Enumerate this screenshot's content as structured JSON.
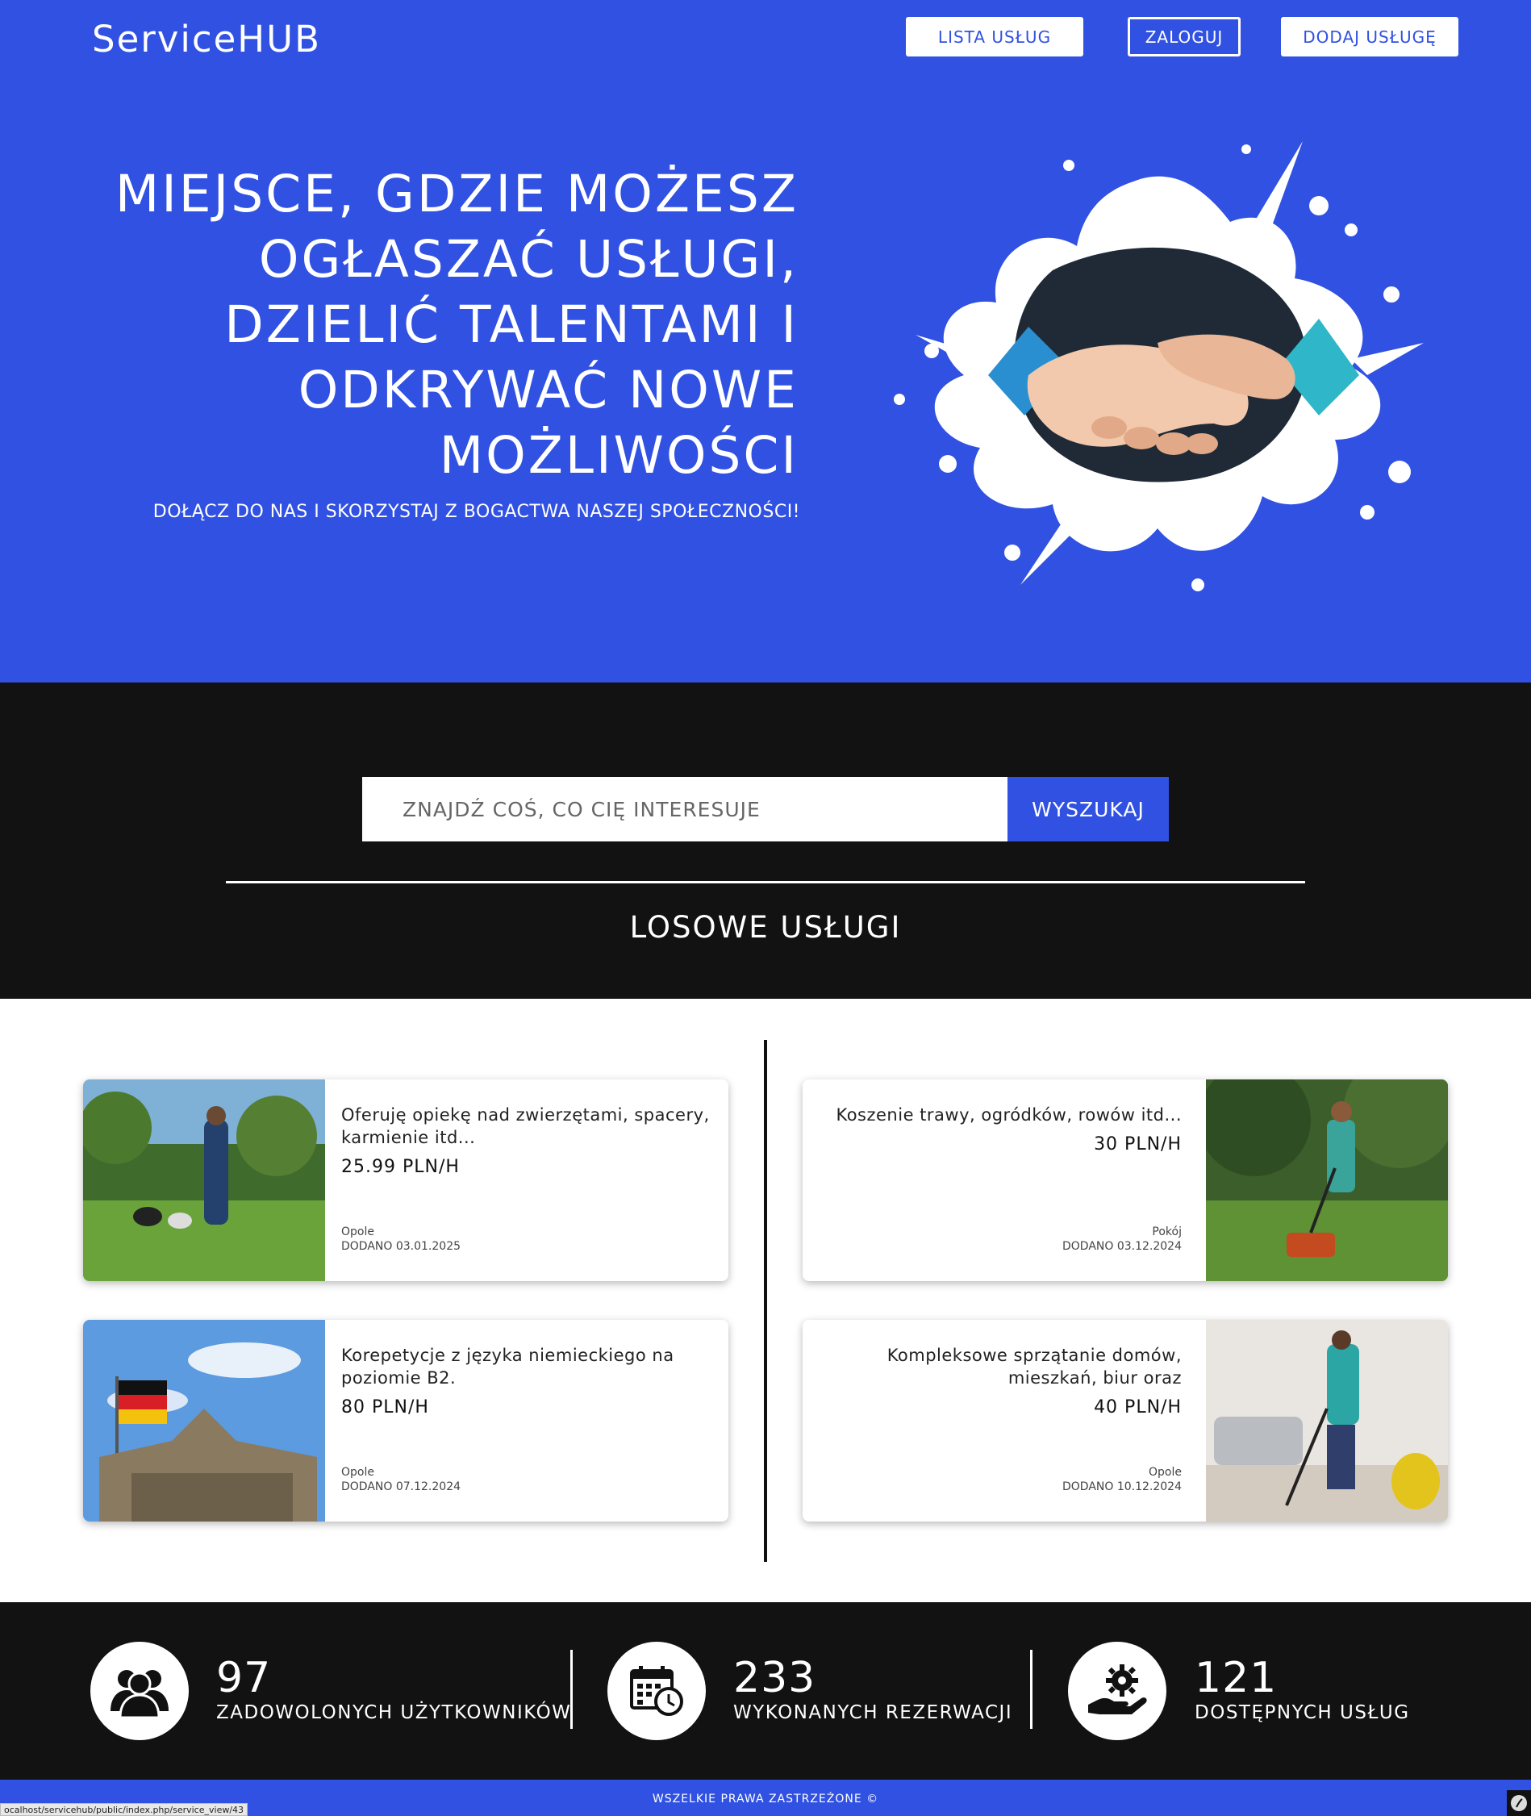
{
  "header": {
    "brand": "ServiceHUB",
    "nav": {
      "list": "LISTA USŁUG",
      "login": "ZALOGUJ",
      "add": "DODAJ USŁUGĘ"
    }
  },
  "hero": {
    "headline_lines": [
      "MIEJSCE, GDZIE MOŻESZ",
      "OGŁASZAĆ USŁUGI,",
      "DZIELIĆ TALENTAMI I",
      "ODKRYWAĆ NOWE",
      "MOŻLIWOŚCI"
    ],
    "subline": "DOŁĄCZ DO NAS I SKORZYSTAJ Z BOGACTWA NASZEJ SPOŁECZNOŚCI!"
  },
  "search": {
    "placeholder": "ZNAJDŹ COŚ, CO CIĘ INTERESUJE",
    "button": "WYSZUKAJ"
  },
  "section_title": "LOSOWE USŁUGI",
  "services": [
    {
      "title": "Oferuję opiekę nad zwierzętami, spacery, karmienie itd...",
      "price": "25.99 PLN/H",
      "city": "Opole",
      "added": "DODANO 03.01.2025",
      "image": "dog-walking-photo"
    },
    {
      "title": "Koszenie trawy, ogródków, rowów itd...",
      "price": "30 PLN/H",
      "city": "Pokój",
      "added": "DODANO 03.12.2024",
      "image": "lawn-mowing-photo"
    },
    {
      "title": "Korepetycje z języka niemieckiego na poziomie B2.",
      "price": "80 PLN/H",
      "city": "Opole",
      "added": "DODANO 07.12.2024",
      "image": "german-flag-photo"
    },
    {
      "title": "Kompleksowe sprzątanie domów, mieszkań, biur oraz",
      "price": "40 PLN/H",
      "city": "Opole",
      "added": "DODANO 10.12.2024",
      "image": "house-cleaning-photo"
    }
  ],
  "stats": [
    {
      "value": "97",
      "label": "ZADOWOLONYCH UŻYTKOWNIKÓW",
      "icon": "users-icon"
    },
    {
      "value": "233",
      "label": "WYKONANYCH REZERWACJI",
      "icon": "calendar-clock-icon"
    },
    {
      "value": "121",
      "label": "DOSTĘPNYCH USŁUG",
      "icon": "hand-gear-icon"
    }
  ],
  "footer": {
    "text": "WSZELKIE PRAWA ZASTRZEŻONE ©"
  },
  "status_bar": {
    "url": "ocalhost/servicehub/public/index.php/service_view/43"
  },
  "colors": {
    "primary": "#3051e2",
    "dark": "#121212",
    "white": "#ffffff"
  }
}
